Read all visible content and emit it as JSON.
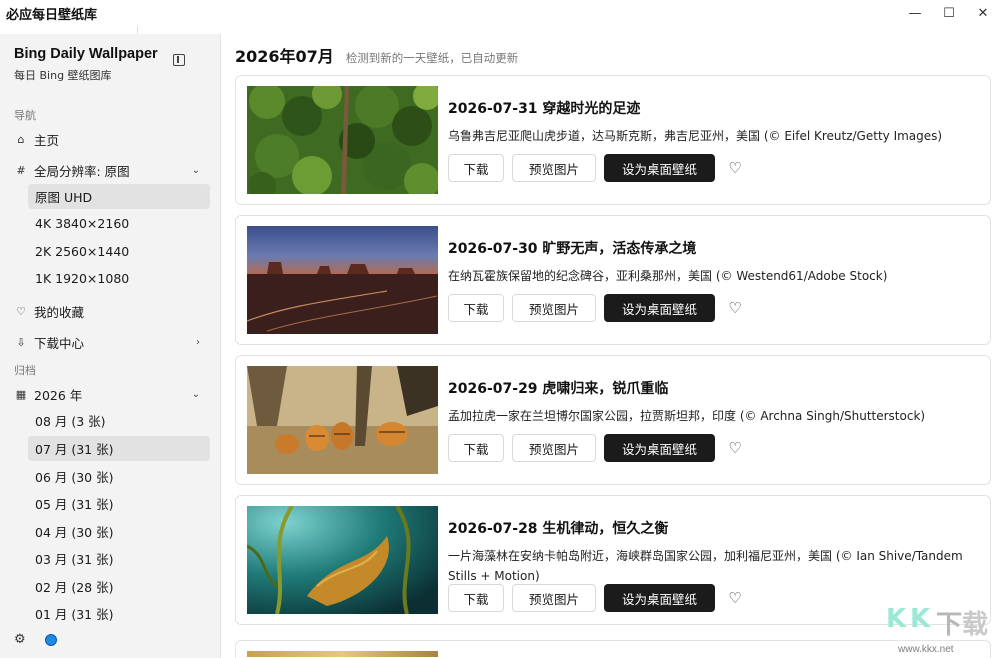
{
  "window": {
    "title": "必应每日壁纸库",
    "controls": [
      "minimize",
      "maximize",
      "close"
    ]
  },
  "sidebar": {
    "title": "Bing Daily Wallpaper",
    "subtitle": "每日 Bing 壁纸图库",
    "nav_section_label": "导航",
    "home_label": "主页",
    "resolution_label": "全局分辨率: 原图",
    "resolution_options": [
      {
        "label": "原图 UHD",
        "selected": true
      },
      {
        "label": "4K 3840×2160",
        "selected": false
      },
      {
        "label": "2K 2560×1440",
        "selected": false
      },
      {
        "label": "1K 1920×1080",
        "selected": false
      }
    ],
    "favorites_label": "我的收藏",
    "downloads_label": "下载中心",
    "archive_section_label": "归档",
    "year_label": "2026 年",
    "months": [
      {
        "label": "08 月 (3 张)",
        "selected": false
      },
      {
        "label": "07 月 (31 张)",
        "selected": true
      },
      {
        "label": "06 月 (30 张)",
        "selected": false
      },
      {
        "label": "05 月 (31 张)",
        "selected": false
      },
      {
        "label": "04 月 (30 张)",
        "selected": false
      },
      {
        "label": "03 月 (31 张)",
        "selected": false
      },
      {
        "label": "02 月 (28 张)",
        "selected": false
      },
      {
        "label": "01 月 (31 张)",
        "selected": false
      }
    ]
  },
  "main": {
    "title": "2026年07月",
    "subtitle": "检测到新的一天壁纸，已自动更新",
    "cards": [
      {
        "title": "2026-07-31 穿越时光的足迹",
        "description": "乌鲁弗吉尼亚爬山虎步道，达马斯克斯，弗吉尼亚州，美国 (© Eifel Kreutz/Getty Images)",
        "image": "forest-path-aerial"
      },
      {
        "title": "2026-07-30 旷野无声，活态传承之境",
        "description": "在纳瓦霍族保留地的纪念碑谷，亚利桑那州，美国 (© Westend61/Adobe Stock)",
        "image": "monument-valley-dusk"
      },
      {
        "title": "2026-07-29 虎啸归来，锐爪重临",
        "description": "孟加拉虎一家在兰坦博尔国家公园，拉贾斯坦邦，印度 (© Archna Singh/Shutterstock)",
        "image": "tiger-family"
      },
      {
        "title": "2026-07-28 生机律动，恒久之衡",
        "description": "一片海藻林在安纳卡帕岛附近，海峡群岛国家公园，加利福尼亚州，美国 (© Ian Shive/Tandem Stills + Motion)",
        "image": "kelp-forest"
      }
    ],
    "buttons": {
      "download": "下载",
      "preview": "预览图片",
      "set_wallpaper": "设为桌面壁纸"
    }
  },
  "watermark": {
    "text": "KK下载",
    "url": "www.kkx.net"
  }
}
